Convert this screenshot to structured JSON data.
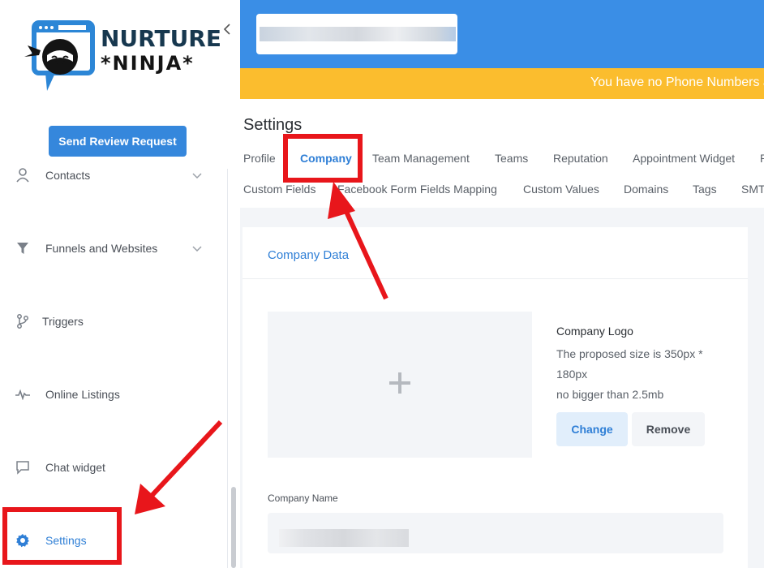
{
  "brand": {
    "logo_line1": "NURTURE",
    "logo_line2": "*NINJA*",
    "accent": "#3a8ee6",
    "warning": "#fbbd2e",
    "highlight": "#e8161b"
  },
  "sidebar": {
    "collapse_icon": "chevron-left-icon",
    "send_review_label": "Send Review Request",
    "items": [
      {
        "label": "Contacts",
        "icon": "user-icon",
        "expandable": true
      },
      {
        "label": "Funnels and Websites",
        "icon": "funnel-icon",
        "expandable": true
      },
      {
        "label": "Triggers",
        "icon": "branch-icon",
        "expandable": false
      },
      {
        "label": "Online Listings",
        "icon": "pulse-icon",
        "expandable": false
      },
      {
        "label": "Chat widget",
        "icon": "chat-icon",
        "expandable": false
      },
      {
        "label": "Settings",
        "icon": "gear-icon",
        "expandable": false,
        "active": true
      }
    ]
  },
  "notice": {
    "text": "You have no Phone Numbers a"
  },
  "settings": {
    "title": "Settings",
    "tabs_row1": [
      "Profile",
      "Company",
      "Team Management",
      "Teams",
      "Reputation",
      "Appointment Widget",
      "P"
    ],
    "tabs_row2": [
      "Custom Fields",
      "Facebook Form Fields Mapping",
      "Custom Values",
      "Domains",
      "Tags",
      "SMT"
    ],
    "active_tab": "Company"
  },
  "company": {
    "card_title": "Company Data",
    "logo_label": "Company Logo",
    "logo_hint_1": "The proposed size is 350px *",
    "logo_hint_2": "180px",
    "logo_hint_3": "no bigger than 2.5mb",
    "change_label": "Change",
    "remove_label": "Remove",
    "name_label": "Company Name"
  }
}
